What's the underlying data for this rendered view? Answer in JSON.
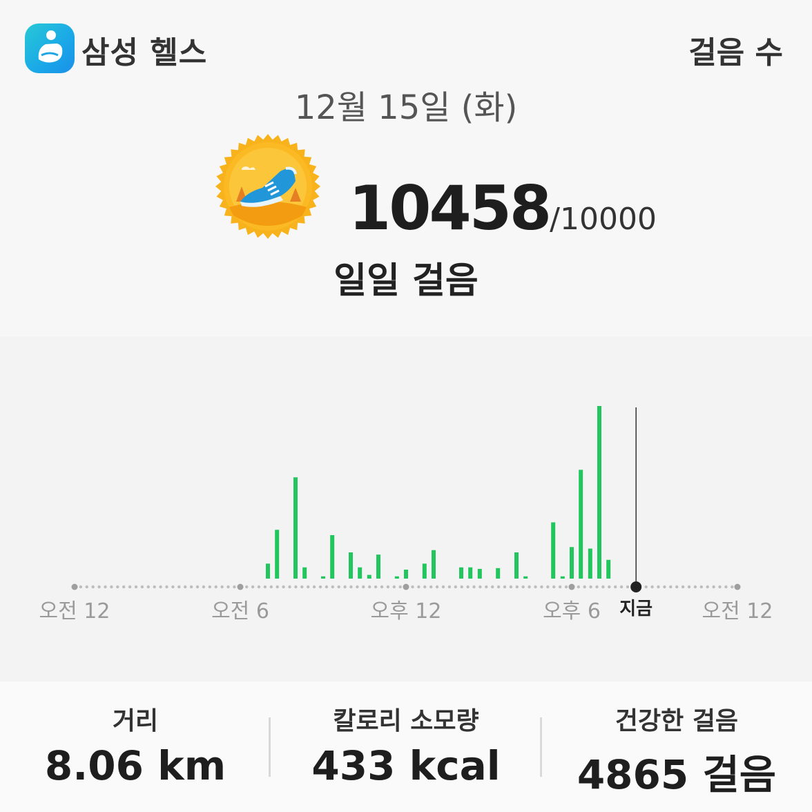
{
  "header": {
    "app_name": "삼성 헬스",
    "page_title": "걸음 수",
    "app_icon": "samsung-health-icon"
  },
  "summary": {
    "date": "12월 15일 (화)",
    "steps": "10458",
    "goal": "/10000",
    "subtitle": "일일 걸음",
    "badge_icon": "sneaker-icon",
    "badge_color": "#f5a623"
  },
  "chart_data": {
    "type": "bar",
    "x_labels": [
      "오전 12",
      "오전 6",
      "오후 12",
      "오후 6",
      "오전 12"
    ],
    "now_label": "지금",
    "now_hour": 20.33,
    "bar_color": "#22c55e",
    "x_range_hours": [
      0,
      24
    ],
    "bars": [
      {
        "hour": 7.0,
        "value": 20
      },
      {
        "hour": 7.33,
        "value": 65
      },
      {
        "hour": 8.0,
        "value": 135
      },
      {
        "hour": 8.33,
        "value": 15
      },
      {
        "hour": 9.0,
        "value": 3
      },
      {
        "hour": 9.33,
        "value": 58
      },
      {
        "hour": 10.0,
        "value": 35
      },
      {
        "hour": 10.33,
        "value": 15
      },
      {
        "hour": 10.67,
        "value": 5
      },
      {
        "hour": 11.0,
        "value": 32
      },
      {
        "hour": 11.67,
        "value": 3
      },
      {
        "hour": 12.0,
        "value": 12
      },
      {
        "hour": 12.67,
        "value": 20
      },
      {
        "hour": 13.0,
        "value": 38
      },
      {
        "hour": 14.0,
        "value": 15
      },
      {
        "hour": 14.33,
        "value": 15
      },
      {
        "hour": 14.67,
        "value": 13
      },
      {
        "hour": 15.33,
        "value": 14
      },
      {
        "hour": 16.0,
        "value": 35
      },
      {
        "hour": 16.33,
        "value": 3
      },
      {
        "hour": 17.33,
        "value": 75
      },
      {
        "hour": 17.67,
        "value": 3
      },
      {
        "hour": 18.0,
        "value": 42
      },
      {
        "hour": 18.33,
        "value": 145
      },
      {
        "hour": 18.67,
        "value": 40
      },
      {
        "hour": 19.0,
        "value": 230
      },
      {
        "hour": 19.33,
        "value": 25
      }
    ]
  },
  "stats": [
    {
      "label": "거리",
      "value": "8.06 km"
    },
    {
      "label": "칼로리 소모량",
      "value": "433 kcal"
    },
    {
      "label": "건강한 걸음",
      "value": "4865 걸음"
    }
  ]
}
